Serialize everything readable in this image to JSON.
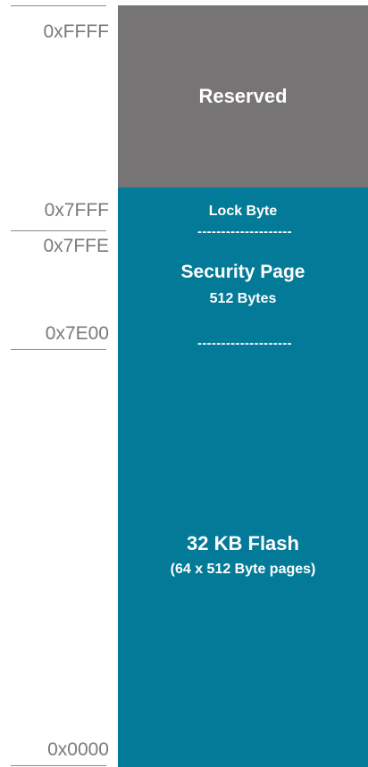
{
  "addresses": {
    "top": "0xFFFF",
    "lock_byte": "0x7FFF",
    "security_start": "0x7FFE",
    "security_end": "0x7E00",
    "bottom": "0x0000"
  },
  "regions": {
    "reserved": {
      "label": "Reserved",
      "color": "#767474"
    },
    "lock_byte": {
      "label": "Lock Byte"
    },
    "security_page": {
      "label": "Security Page",
      "sublabel": "512 Bytes"
    },
    "flash": {
      "label": "32 KB Flash",
      "sublabel": "(64 x 512 Byte pages)",
      "color": "#037a97"
    }
  },
  "separator": "--------------------"
}
